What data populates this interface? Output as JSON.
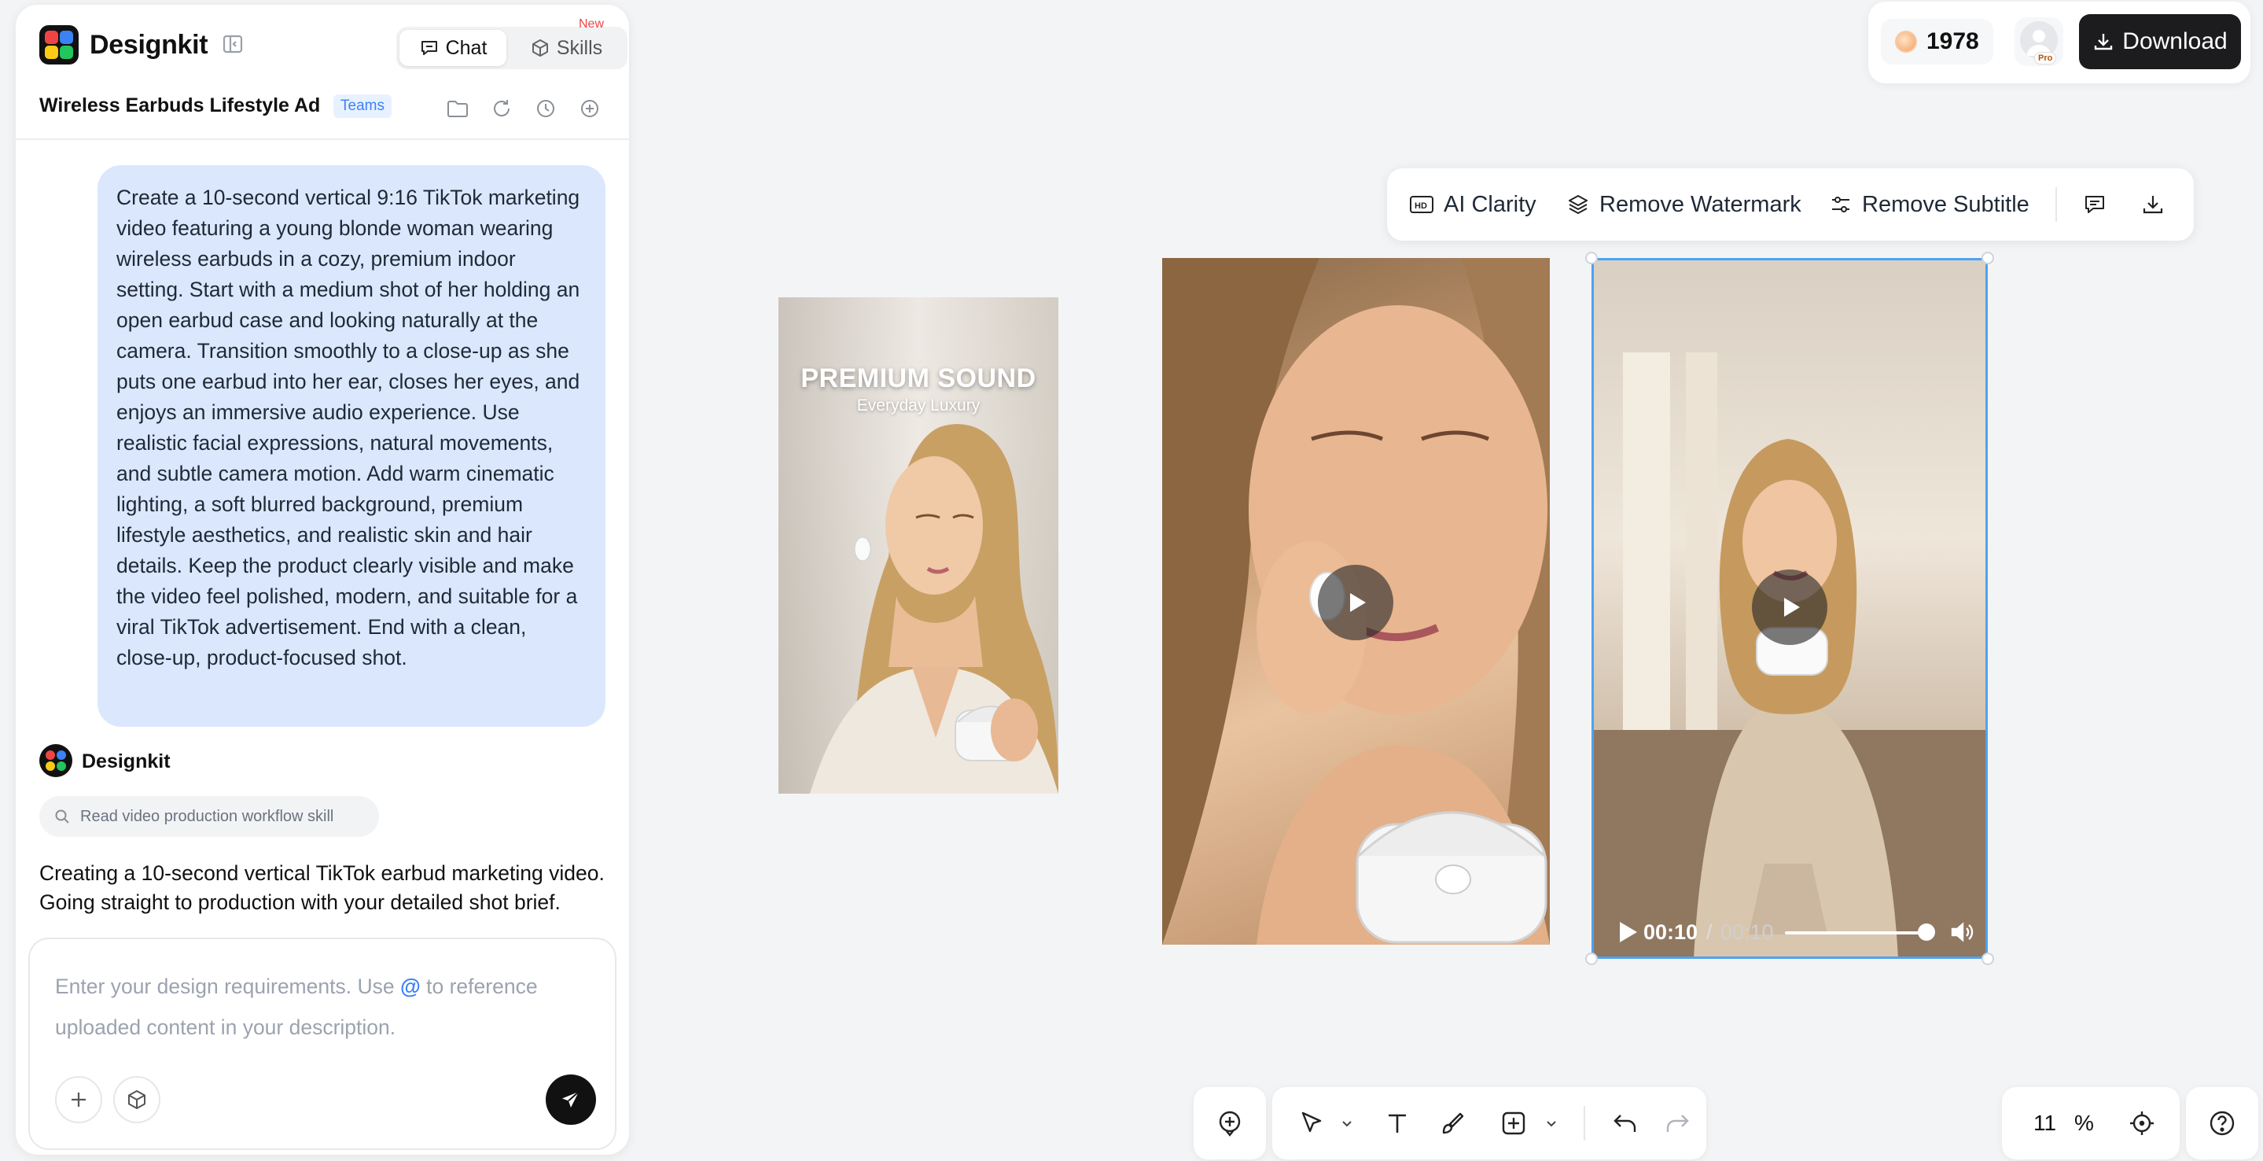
{
  "app": {
    "name": "Designkit"
  },
  "mode_tabs": {
    "chat": "Chat",
    "skills": "Skills",
    "new_badge": "New"
  },
  "project": {
    "title": "Wireless Earbuds Lifestyle Ad",
    "badge": "Teams"
  },
  "chat": {
    "user_message": "Create a 10-second vertical 9:16 TikTok marketing video featuring a young blonde woman wearing wireless earbuds in a cozy, premium indoor setting. Start with a medium shot of her holding an open earbud case and looking naturally at the camera. Transition smoothly to a close-up as she puts one earbud into her ear, closes her eyes, and enjoys an immersive audio experience. Use realistic facial expressions, natural movements, and subtle camera motion. Add warm cinematic lighting, a soft blurred background, premium lifestyle aesthetics, and realistic skin and hair details. Keep the product clearly visible and make the video feel polished, modern, and suitable for a viral TikTok advertisement. End with a clean, close-up, product-focused shot.",
    "bot_name": "Designkit",
    "tool_step": "Read video production workflow skill",
    "bot_message": "Creating a 10-second vertical TikTok earbud marketing video. Going straight to production with your detailed shot brief."
  },
  "input": {
    "placeholder_before": "Enter your design requirements. Use ",
    "placeholder_at": "@",
    "placeholder_after": " to reference uploaded content in your description."
  },
  "topbar": {
    "credits": "1978",
    "pro_badge": "Pro",
    "download_label": "Download"
  },
  "float_toolbar": {
    "ai_clarity": "AI Clarity",
    "remove_watermark": "Remove Watermark",
    "remove_subtitle": "Remove Subtitle"
  },
  "canvas": {
    "image1": {
      "headline": "PREMIUM SOUND",
      "subhead": "Everyday Luxury"
    },
    "video3": {
      "current_time": "00:10",
      "separator": "/",
      "total_time": "00:10",
      "progress": 1.0
    }
  },
  "zoom": {
    "value": "11",
    "unit": "%"
  },
  "icons": [
    "sidebar-collapse-icon",
    "chat-icon",
    "skills-cube-icon",
    "folder-icon",
    "refresh-icon",
    "history-icon",
    "new-chat-icon",
    "search-icon",
    "plus-icon",
    "cube-icon",
    "send-icon",
    "coin-icon",
    "download-icon",
    "hd-icon",
    "layers-icon",
    "sliders-icon",
    "comment-icon",
    "play-icon",
    "volume-icon",
    "add-node-icon",
    "pointer-icon",
    "text-icon",
    "brush-icon",
    "add-box-icon",
    "undo-icon",
    "redo-icon",
    "focus-icon",
    "help-icon"
  ],
  "colors": {
    "accent": "#3b82f6",
    "bubble": "#dbe7fd",
    "selection": "#4da3f2",
    "dark_button": "#1c1c1e",
    "new_badge": "#ef4444"
  }
}
